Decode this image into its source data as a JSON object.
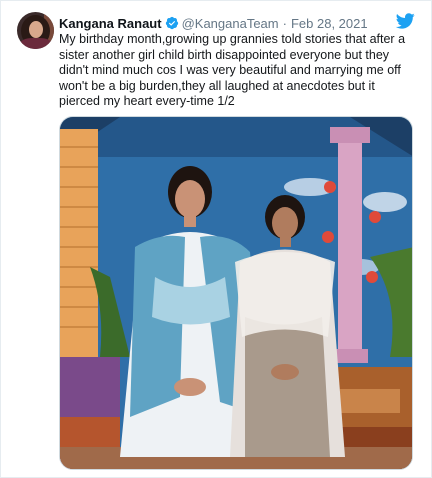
{
  "tweet": {
    "author_name": "Kangana Ranaut",
    "handle": "@KanganaTeam",
    "separator": "·",
    "date": "Feb 28, 2021",
    "text": "My birthday month,growing up grannies told stories that after a sister another girl child birth disappointed everyone but they didn't mind much cos I was very beautiful and marrying me off won't be a big burden,they all laughed at anecdotes but it pierced my heart every-time 1/2",
    "icons": {
      "verified": "verified-badge-icon",
      "logo": "twitter-bird-icon"
    },
    "colors": {
      "verified": "#1da1f2",
      "logo": "#1da1f2",
      "muted": "#657786"
    }
  }
}
